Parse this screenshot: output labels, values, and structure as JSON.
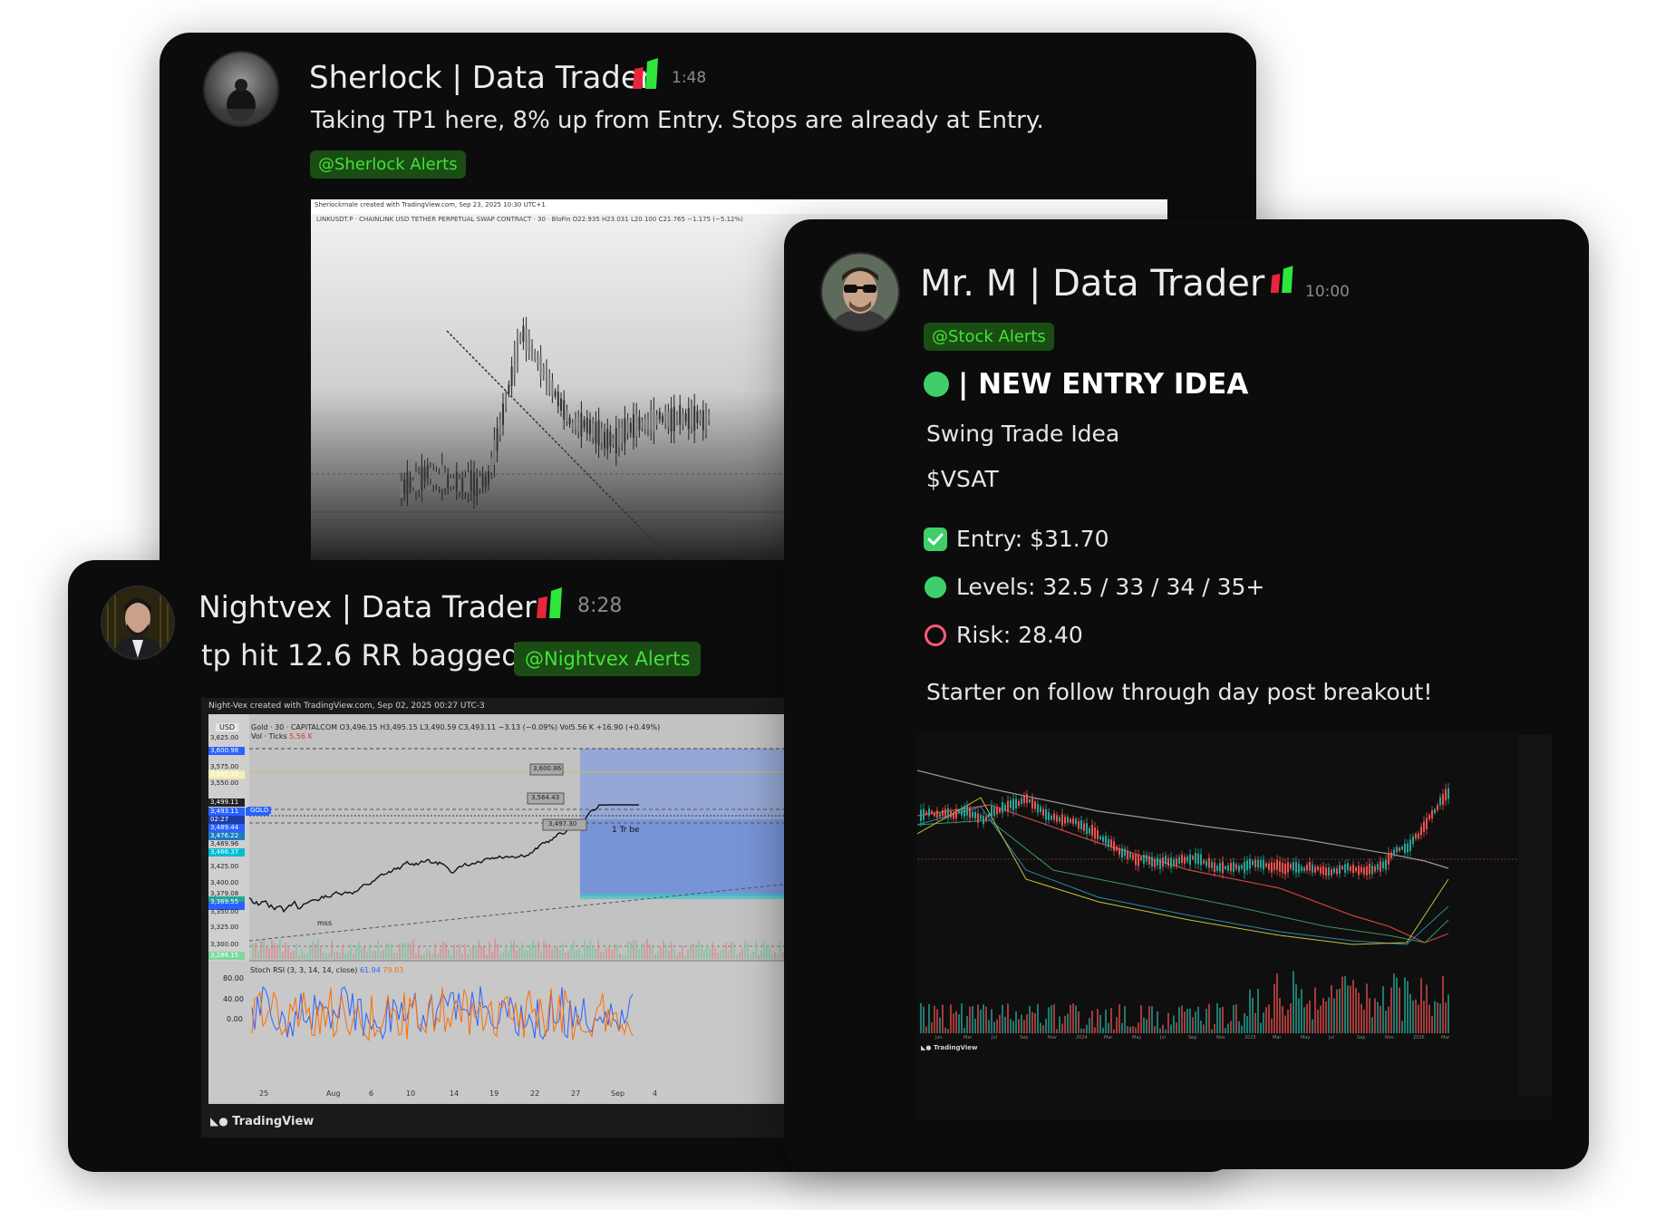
{
  "colors": {
    "card_bg": "#0c0c0c",
    "mention_bg": "#1a4d14",
    "mention_text": "#43e23a",
    "entry_green": "#3ecf6a",
    "risk_red": "#ff5a78",
    "candle_up": "#26a69a",
    "candle_down": "#ef5350"
  },
  "icons": {
    "data_trader_badge": "red-green-bar-icon",
    "entry_icon": "green-check-icon",
    "levels_icon": "green-circle-icon",
    "risk_icon": "red-circle-outline-icon",
    "tradingview_logo": "tradingview-logo-icon"
  },
  "sherlock": {
    "name": "Sherlock | Data Trader",
    "time": "1:48",
    "message": "Taking TP1 here, 8% up from Entry. Stops are already at Entry.",
    "mention": "@Sherlock Alerts",
    "chart": {
      "caption": "Sherlockrnale created with TradingView.com, Sep 23, 2025 10:30 UTC+1",
      "symbol_line": "LINKUSDT.P · CHAINLINK USD TETHER PERPETUAL SWAP CONTRACT · 30 · BloFin  O22.935 H23.031 L20.100 C21.765 −1.175 (−5.12%)"
    }
  },
  "nightvex": {
    "name": "Nightvex | Data Trader",
    "time": "8:28",
    "message": "tp hit 12.6 RR bagged",
    "mention": "@Nightvex Alerts",
    "chart": {
      "caption": "Night-Vex created with TradingView.com, Sep 02, 2025 00:27 UTC-3",
      "currency": "USD",
      "symbol_line": "Gold · 30 · CAPITALCOM  O3,496.15 H3,495.15 L3,490.59 C3,493.11 −3.13 (−0.09%)  Vol5.56 K +16.90 (+0.49%)",
      "vol_line": "Vol · Ticks",
      "vol_value": "5.56 K",
      "price_labels": [
        "3,625.00",
        "3,600.98",
        "3,575.00",
        "3,565.33",
        "3,550.00",
        "3,499.11",
        "3,493.11",
        "02:27",
        "3,489.44",
        "3,476.22",
        "3,469.96",
        "3,466.37",
        "3,425.00",
        "3,400.00",
        "3,379.08",
        "3,369.55",
        "3,350.00",
        "3,325.00",
        "3,300.00",
        "3,286.15"
      ],
      "gold_tag": "GOLD",
      "box_labels": [
        "3,600.86",
        "3,564.43",
        "3,497.30"
      ],
      "rr_label": "1 Tr be",
      "mss_label": "mss",
      "rsi_label": "Stoch RSI (3, 3, 14, 14, close)",
      "rsi_k": "61.94",
      "rsi_d": "79.03",
      "rsi_ticks": [
        "80.00",
        "40.00",
        "0.00"
      ],
      "x_labels": [
        "25",
        "Aug",
        "6",
        "10",
        "14",
        "19",
        "22",
        "27",
        "Sep",
        "4"
      ],
      "footer": "TradingView"
    }
  },
  "mrm": {
    "name": "Mr. M | Data Trader",
    "time": "10:00",
    "mention": "@Stock Alerts",
    "headline": "| NEW ENTRY IDEA",
    "subtitle": "Swing Trade Idea",
    "ticker": "$VSAT",
    "entry": "Entry: $31.70",
    "levels": "Levels: 32.5 / 33 / 34 / 35+",
    "risk": "Risk: 28.40",
    "note": "Starter on follow through day post breakout!",
    "chart": {
      "footer": "TradingView",
      "x_labels": [
        "Jan",
        "Mar",
        "Jul",
        "Sep",
        "Nov",
        "2024",
        "Mar",
        "May",
        "Jul",
        "Sep",
        "Nov",
        "2025",
        "Mar",
        "May",
        "Jul",
        "Sep",
        "Nov",
        "2026",
        "Mar"
      ]
    }
  }
}
